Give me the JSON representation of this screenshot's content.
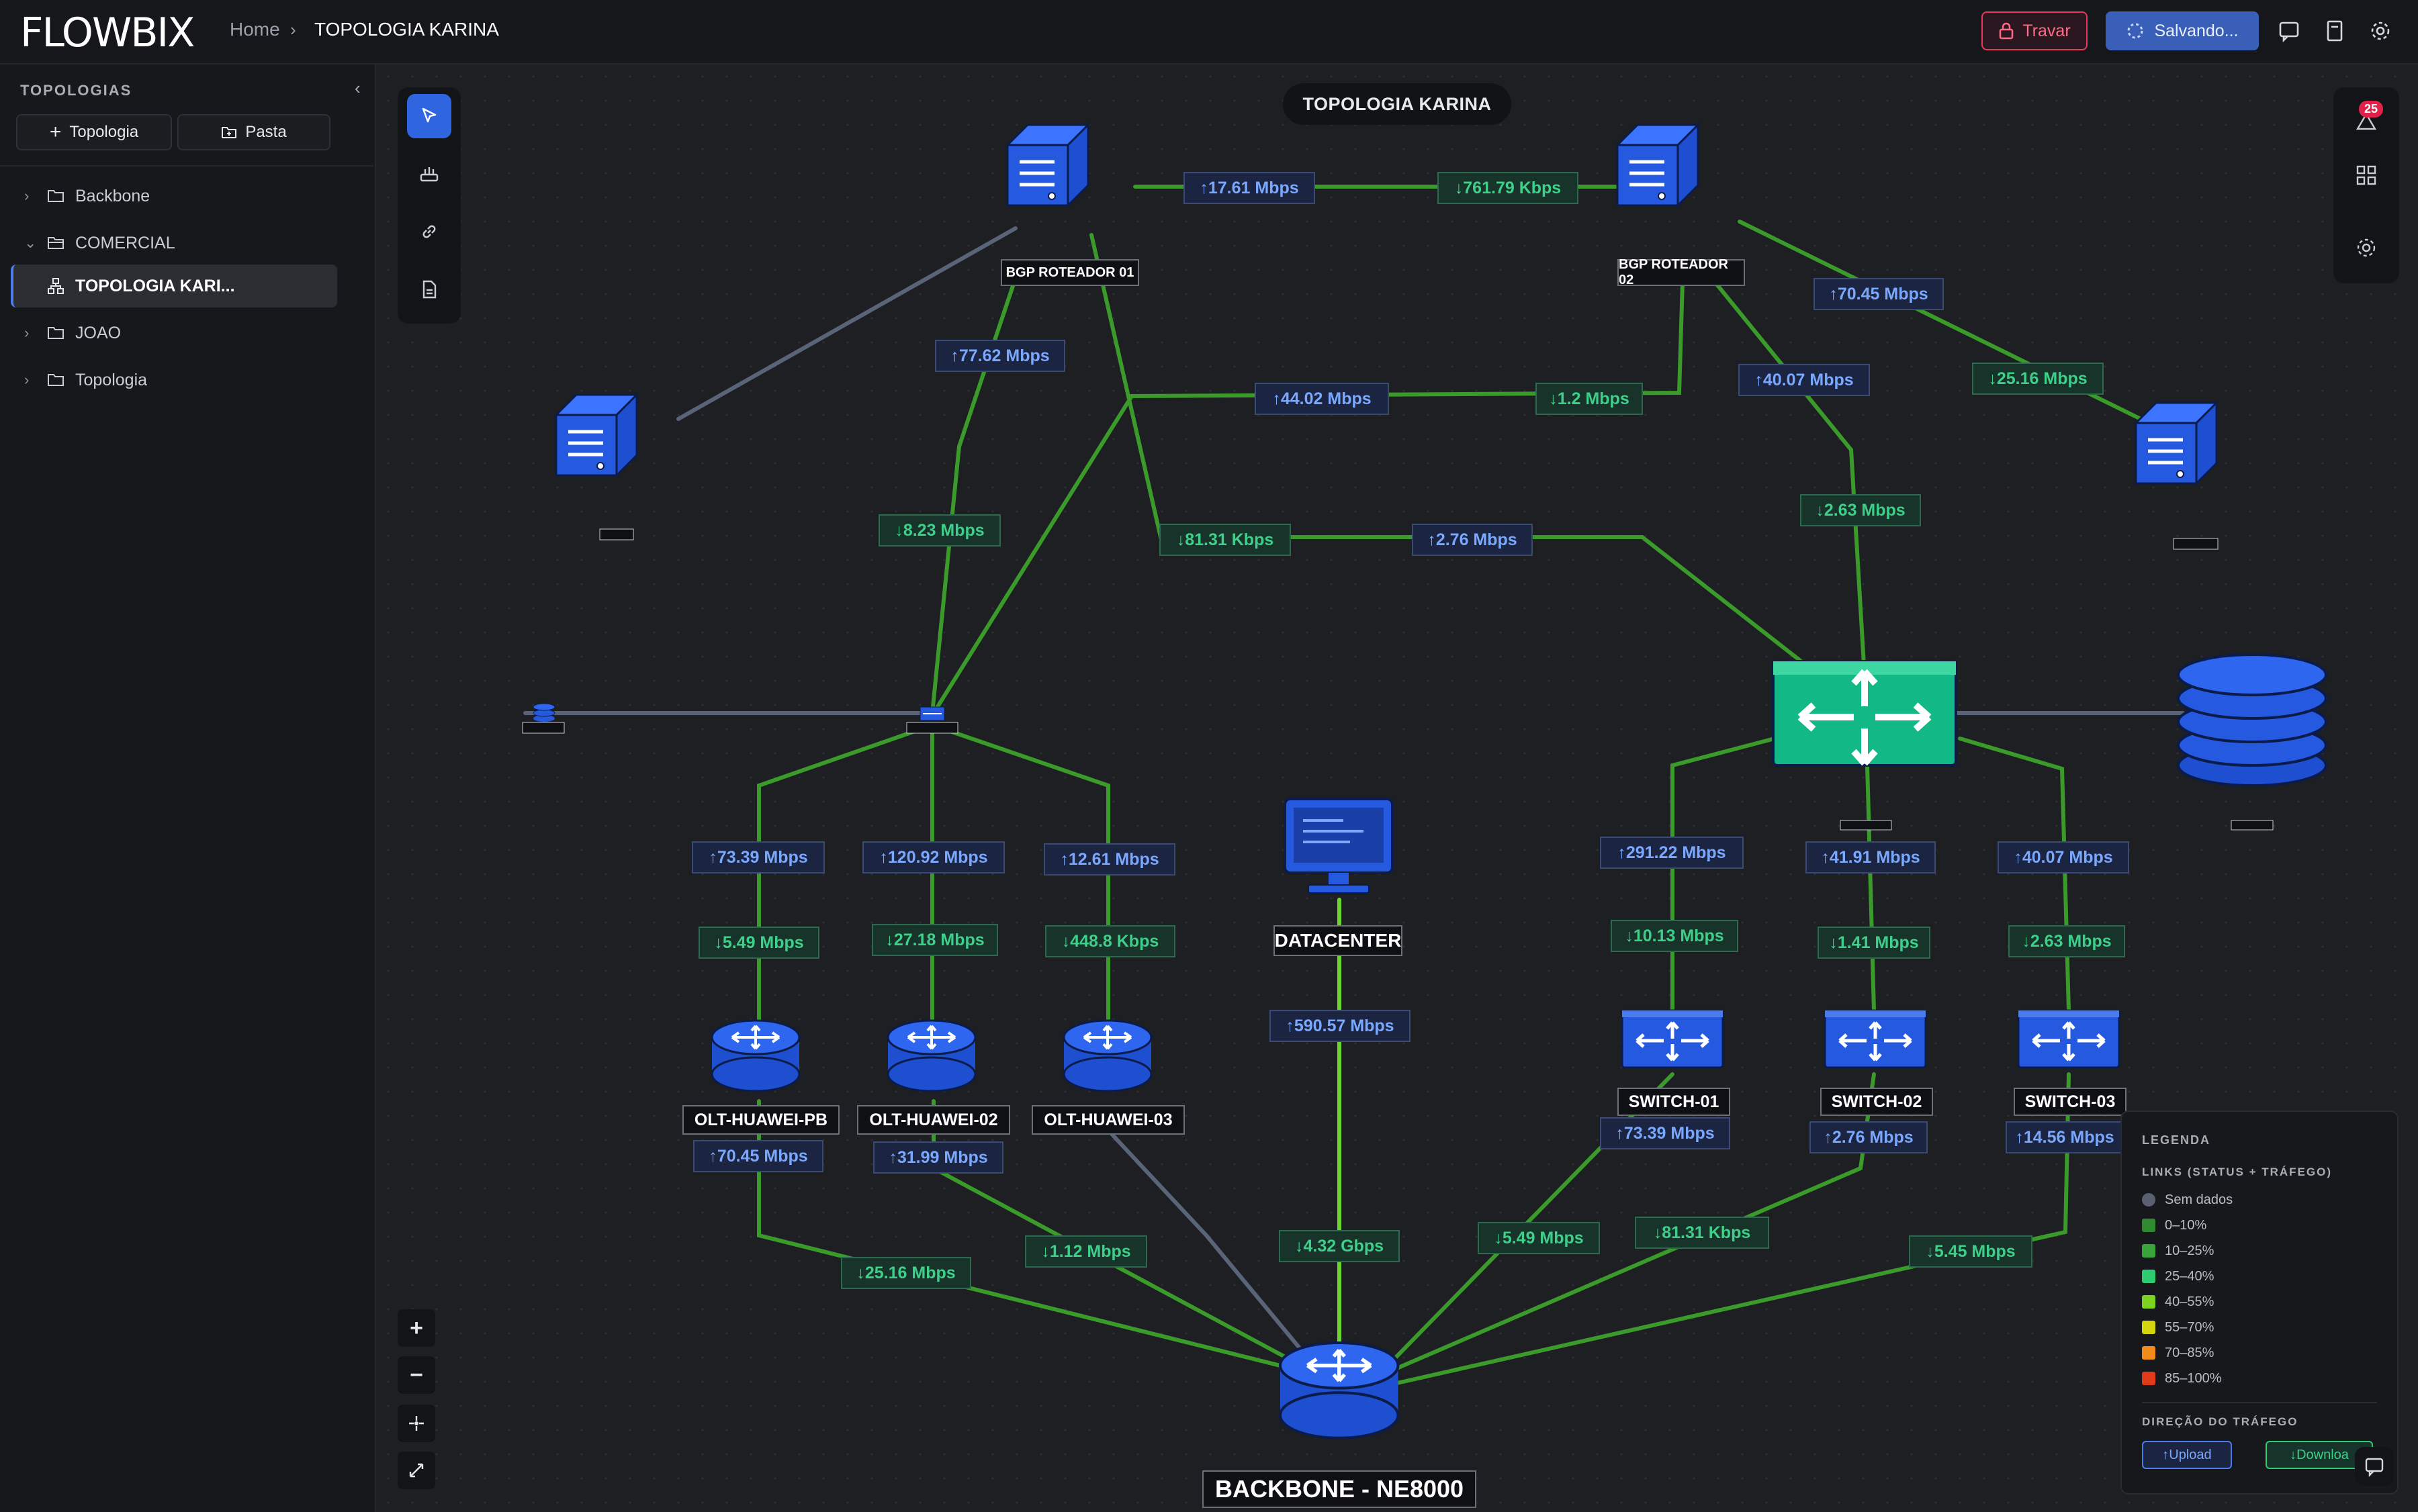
{
  "app": {
    "logo": "FLOWBIX"
  },
  "breadcrumb": {
    "home": "Home",
    "separator": "›",
    "current": "TOPOLOGIA KARINA"
  },
  "header": {
    "lock_label": "Travar",
    "saving_label": "Salvando...",
    "icons": [
      "lock-icon",
      "spinner-icon",
      "chat-icon",
      "document-icon",
      "settings-icon"
    ]
  },
  "sidebar": {
    "title": "TOPOLOGIAS",
    "add_topology": "Topologia",
    "add_folder": "Pasta",
    "tree": [
      {
        "label": "Backbone",
        "expanded": false
      },
      {
        "label": "COMERCIAL",
        "expanded": true
      },
      {
        "label": "TOPOLOGIA KARI...",
        "selected": true
      },
      {
        "label": "JOAO",
        "expanded": false
      },
      {
        "label": "Topologia",
        "expanded": false
      }
    ]
  },
  "canvas": {
    "title": "TOPOLOGIA KARINA",
    "notification_count": "25",
    "colors": {
      "link_green": "#3a9a2a",
      "link_bright": "#6ad62a",
      "link_gray": "#5a6478",
      "node_blue": "#2559e0",
      "switch_green": "#12b886",
      "label_up": "#7aa8ff",
      "label_down": "#3ed08a"
    }
  },
  "nodes": {
    "bgp1": "BGP ROTEADOR 01",
    "bgp2": "BGP ROTEADOR 02",
    "olt1": "OLT-HUAWEI-PB",
    "olt2": "OLT-HUAWEI-02",
    "olt3": "OLT-HUAWEI-03",
    "sw1": "SWITCH-01",
    "sw2": "SWITCH-02",
    "sw3": "SWITCH-03",
    "datacenter": "DATACENTER",
    "backbone": "BACKBONE - NE8000"
  },
  "links": {
    "bgp_up": "17.61 Mbps",
    "bgp_down": "761.79 Kbps",
    "bgp2_r_up": "70.45 Mbps",
    "bgp2_r_down": "25.16 Mbps",
    "bgp1_a_up": "77.62 Mbps",
    "bgp1_a_down": "8.23 Mbps",
    "bgp2_a_up": "44.02 Mbps",
    "bgp2_a_down": "1.2 Mbps",
    "bgp2_b_up": "40.07 Mbps",
    "bgp2_b_down": "2.63 Mbps",
    "bgp1_b_down": "81.31 Kbps",
    "bgp1_b_up": "2.76 Mbps",
    "olt1_up": "73.39 Mbps",
    "olt1_down": "5.49 Mbps",
    "olt2_up": "120.92 Mbps",
    "olt2_down": "27.18 Mbps",
    "olt3_up": "12.61 Mbps",
    "olt3_down": "448.8 Kbps",
    "sw1_up": "291.22 Mbps",
    "sw1_down": "10.13 Mbps",
    "sw2_up": "41.91 Mbps",
    "sw2_down": "1.41 Mbps",
    "sw3_up": "40.07 Mbps",
    "sw3_down": "2.63 Mbps",
    "dc_up": "590.57 Mbps",
    "dc_down": "4.32 Gbps",
    "olt1_bb_up": "70.45 Mbps",
    "olt1_bb_down": "25.16 Mbps",
    "olt2_bb_up": "31.99 Mbps",
    "olt2_bb_down": "1.12 Mbps",
    "sw1_bb_up": "73.39 Mbps",
    "sw1_bb_down": "5.49 Mbps",
    "sw2_bb_up": "2.76 Mbps",
    "sw2_bb_down": "81.31 Kbps",
    "sw3_bb_up": "14.56 Mbps",
    "sw3_bb_down": "5.45 Mbps"
  },
  "legend": {
    "title": "LEGENDA",
    "links_title": "LINKS (STATUS + TRÁFEGO)",
    "items": [
      {
        "label": "Sem dados",
        "color": "#5a6170"
      },
      {
        "label": "0–10%",
        "color": "#2f8a2f"
      },
      {
        "label": "10–25%",
        "color": "#3aa33a"
      },
      {
        "label": "25–40%",
        "color": "#2ecc71"
      },
      {
        "label": "40–55%",
        "color": "#7ed321"
      },
      {
        "label": "55–70%",
        "color": "#d4d40f"
      },
      {
        "label": "70–85%",
        "color": "#f08c1a"
      },
      {
        "label": "85–100%",
        "color": "#e03a1a"
      }
    ],
    "direction_title": "DIREÇÃO DO TRÁFEGO",
    "upload": "Upload",
    "download": "Downloa"
  }
}
